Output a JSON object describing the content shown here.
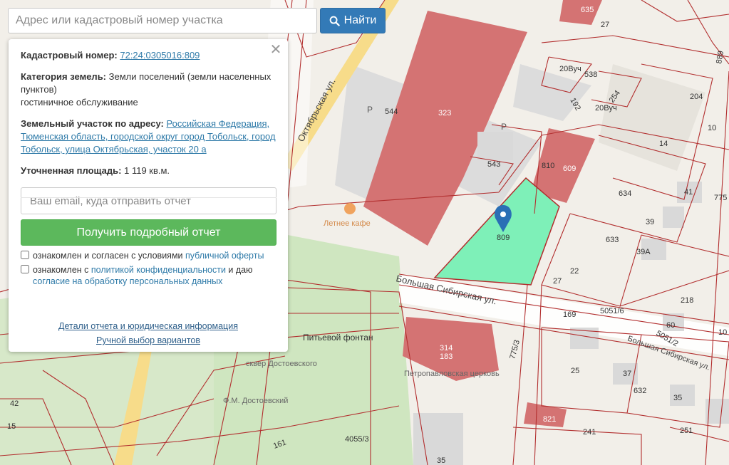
{
  "search": {
    "placeholder": "Адрес или кадастровый номер участка",
    "button_label": "Найти"
  },
  "panel": {
    "cadastral_label": "Кадастровый номер:",
    "cadastral_value": "72:24:0305016:809",
    "category_label": "Категория земель:",
    "category_value": "Земли поселений (земли населенных пунктов)",
    "category_use": "гостиничное обслуживание",
    "address_label": "Земельный участок по адресу:",
    "address_value": "Российская Федерация, Тюменская область, городской округ город Тобольск, город Тобольск, улица Октябрьская, участок 20 а",
    "area_label": "Уточненная площадь:",
    "area_value": "1 119 кв.м.",
    "email_placeholder": "Ваш email, куда отправить отчет",
    "report_button": "Получить подробный отчет",
    "consent1_text": "ознакомлен и согласен с условиями ",
    "consent1_link": "публичной оферты",
    "consent2_text": "ознакомлен с ",
    "consent2_link": "политикой конфиденциальности",
    "consent2_mid": " и даю ",
    "consent2_link2": "согласие на обработку персональных данных",
    "details_link": "Детали отчета и юридическая информация",
    "manual_link": "Ручной выбор вариантов"
  },
  "map": {
    "street_labels": [
      "Октябрьская ул.",
      "Большая Сибирская ул.",
      "Большая Сибирская ул."
    ],
    "parcel_numbers": [
      "635",
      "27",
      "538",
      "20Вуч",
      "192",
      "254",
      "20Вуч",
      "204",
      "10",
      "544",
      "323",
      "P",
      "P",
      "543",
      "810",
      "609",
      "14",
      "634",
      "41",
      "775",
      "39",
      "633",
      "39А",
      "809",
      "22",
      "27",
      "169",
      "5051/6",
      "218",
      "60",
      "5051/2",
      "10",
      "314",
      "183",
      "775/3",
      "25",
      "37",
      "632",
      "35",
      "42",
      "15",
      "161",
      "4055/3",
      "821",
      "241",
      "251",
      "35",
      "889"
    ],
    "poi_labels": [
      "Летнее кафе",
      "Питьевой фонтан",
      "сквер Достоевского",
      "Ф.М. Достоевский",
      "Петропавловская церковь"
    ],
    "selected_parcel": "809",
    "colors": {
      "selected_parcel": "#7ef0b8",
      "building": "#d47373",
      "parcel_line": "#b22f2f",
      "marker": "#2a6fb5"
    }
  }
}
